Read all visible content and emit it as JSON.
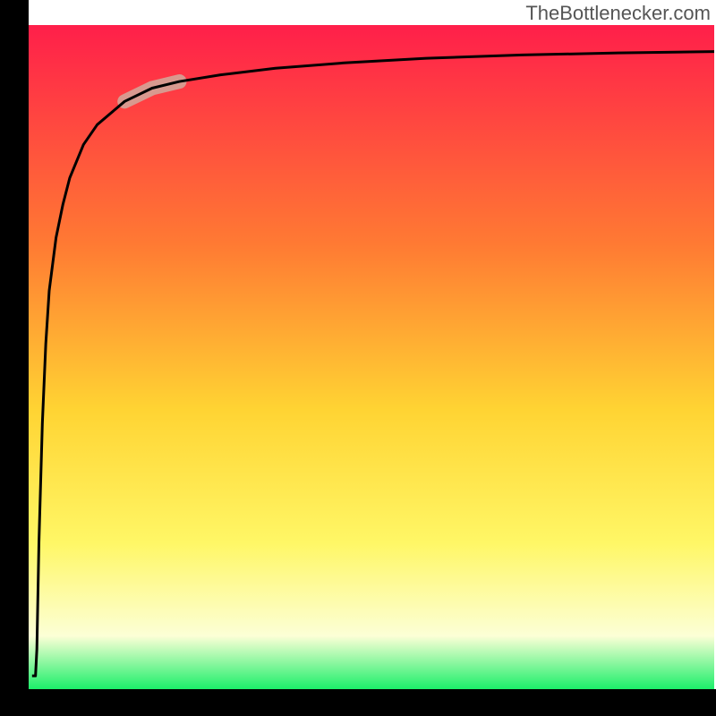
{
  "watermark": "TheBottlenecker.com",
  "colors": {
    "top": "#ff1f4a",
    "mid1": "#ff7a33",
    "mid2": "#ffd433",
    "mid3": "#fff766",
    "mid4": "#fcffd6",
    "bottom": "#1cef6a",
    "axis": "#000000",
    "curve": "#000000",
    "highlight": "#d8998f"
  },
  "chart_data": {
    "type": "line",
    "title": "",
    "xlabel": "",
    "ylabel": "",
    "xlim": [
      0,
      100
    ],
    "ylim": [
      0,
      100
    ],
    "x": [
      0.5,
      1.0,
      1.2,
      1.5,
      2.0,
      2.5,
      3.0,
      4.0,
      5.0,
      6.0,
      8.0,
      10.0,
      14.0,
      18.0,
      22.0,
      28.0,
      36.0,
      46.0,
      58.0,
      72.0,
      86.0,
      100.0
    ],
    "values": [
      2.0,
      2.0,
      6.0,
      22.0,
      40.0,
      52.0,
      60.0,
      68.0,
      73.0,
      77.0,
      82.0,
      85.0,
      88.5,
      90.5,
      91.5,
      92.5,
      93.5,
      94.3,
      95.0,
      95.5,
      95.8,
      96.0
    ],
    "highlight_segment": {
      "x_start": 14.0,
      "x_end": 22.0
    }
  }
}
